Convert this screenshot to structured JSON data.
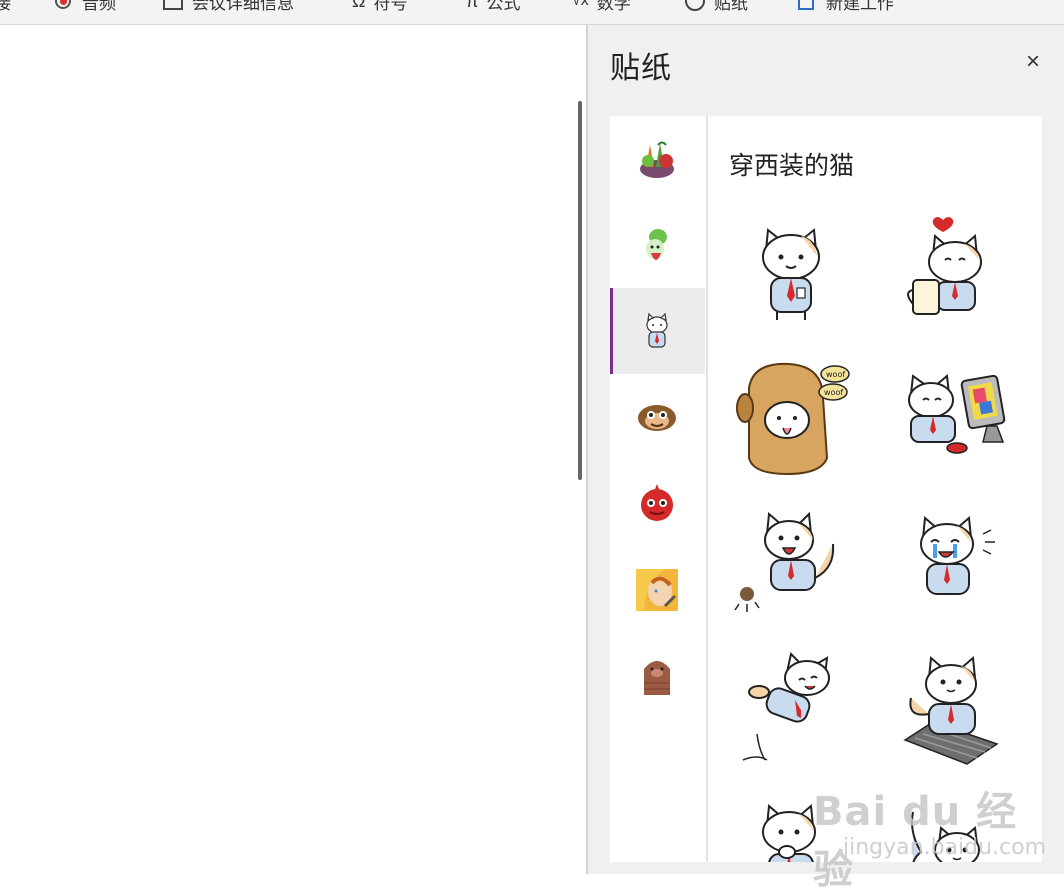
{
  "ribbon": {
    "items": [
      {
        "label": "接"
      },
      {
        "label": "音频"
      },
      {
        "label": "会议详细信息"
      },
      {
        "label": "符号"
      },
      {
        "label": "公式"
      },
      {
        "label": "数学"
      },
      {
        "label": "贴纸"
      },
      {
        "label": "新建工作"
      }
    ]
  },
  "pane": {
    "title": "贴纸",
    "close_label": "×"
  },
  "categories": [
    {
      "icon": "veggie-sticker-icon"
    },
    {
      "icon": "radish-sticker-icon"
    },
    {
      "icon": "cat-in-suit-sticker-icon",
      "selected": true
    },
    {
      "icon": "monkey-sticker-icon"
    },
    {
      "icon": "red-monster-sticker-icon"
    },
    {
      "icon": "comic-woman-sticker-icon"
    },
    {
      "icon": "brown-creature-sticker-icon"
    }
  ],
  "pack": {
    "title": "穿西装的猫",
    "stickers": [
      {
        "name": "cat-standing"
      },
      {
        "name": "cat-with-coffee-heart"
      },
      {
        "name": "cat-in-dog-costume-woof"
      },
      {
        "name": "cat-at-computer"
      },
      {
        "name": "cat-kicking"
      },
      {
        "name": "cat-crying"
      },
      {
        "name": "cat-jumping"
      },
      {
        "name": "cat-on-keyboard"
      },
      {
        "name": "cat-thinking"
      },
      {
        "name": "cat-peeking"
      }
    ],
    "woof_text": "woof"
  },
  "watermark": {
    "main": "Bai du 经验",
    "sub": "jingyan.baidu.com"
  },
  "colors": {
    "accent": "#7b2d8e",
    "tie": "#d42a2a",
    "shirt": "#c9dcef"
  }
}
